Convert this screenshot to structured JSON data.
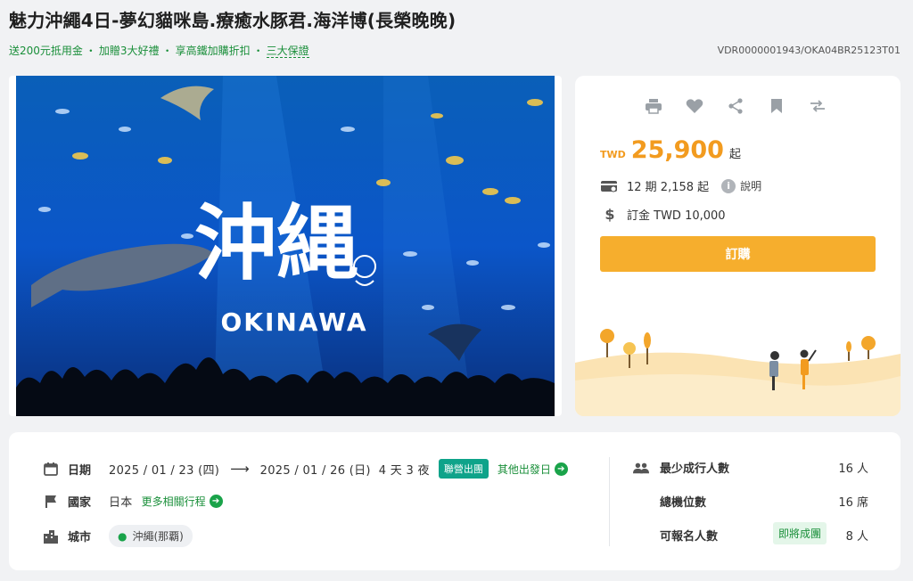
{
  "title": "魅力沖繩4日-夢幻貓咪島.療癒水豚君.海洋博(長榮晚晚)",
  "promo": {
    "items": [
      "送200元抵用金",
      "加贈3大好禮",
      "享高鐵加購折扣"
    ],
    "separator": "・",
    "guarantee": "三大保證"
  },
  "product_code": "VDR0000001943/OKA04BR25123T01",
  "hero": {
    "big_text": "沖縄",
    "sub_text": "OKINAWA"
  },
  "card": {
    "tool_icons": [
      "print-icon",
      "heart-icon",
      "share-icon",
      "bookmark-icon",
      "compare-icon"
    ],
    "currency": "TWD",
    "price": "25,900",
    "price_suffix": "起",
    "installment": "12 期 2,158 起",
    "explain": "說明",
    "deposit": "訂金 TWD 10,000",
    "book_label": "訂購"
  },
  "info": {
    "date_label": "日期",
    "start_date": "2025 / 01 / 23 (四)",
    "end_date": "2025 / 01 / 26 (日)",
    "duration": "4 天 3 夜",
    "tour_type": "聯營出團",
    "other_dates": "其他出發日",
    "country_label": "國家",
    "country": "日本",
    "more_tours": "更多相關行程",
    "city_label": "城市",
    "city": "沖繩(那覇)",
    "min_people_label": "最少成行人數",
    "min_people": "16 人",
    "seats_label": "總機位數",
    "seats": "16 席",
    "available_label": "可報名人數",
    "available_badge": "即將成團",
    "available": "8 人"
  },
  "colors": {
    "accent_orange": "#f29b1f",
    "button_orange": "#f6ae2d",
    "green": "#1a8f3a",
    "teal": "#0fa38a"
  }
}
